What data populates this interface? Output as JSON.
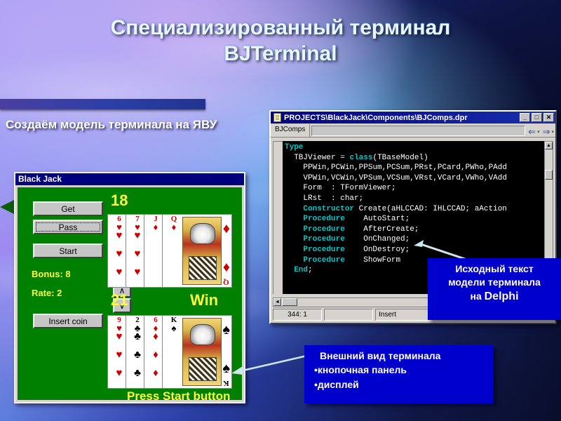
{
  "slide": {
    "title_line1": "Специализированный терминал",
    "title_line2": "BJTerminal",
    "subtitle": "Создаём модель терминала на ЯВУ",
    "accent_color": "#0000cc",
    "title_color": "#e8f6ff"
  },
  "blackjack": {
    "window_title": "Black Jack",
    "buttons": {
      "get": "Get",
      "pass": "Pass",
      "start": "Start",
      "insert_coin": "Insert coin"
    },
    "spinner": {
      "up": "∧",
      "down": "∨"
    },
    "stats": {
      "bonus_label": "Bonus: 8",
      "rate_label": "Rate: 2"
    },
    "score_top": "18",
    "score_bottom": "21",
    "result": "Win",
    "prompt": "Press Start button",
    "hand_top": [
      {
        "rank": "6",
        "suit": "♥",
        "color": "red",
        "face": false
      },
      {
        "rank": "7",
        "suit": "♥",
        "color": "red",
        "face": false
      },
      {
        "rank": "J",
        "suit": "♦",
        "color": "red",
        "face": true
      },
      {
        "rank": "Q",
        "suit": "♦",
        "color": "red",
        "face": true
      }
    ],
    "hand_bottom": [
      {
        "rank": "9",
        "suit": "♥",
        "color": "red",
        "face": false
      },
      {
        "rank": "2",
        "suit": "♣",
        "color": "black",
        "face": false
      },
      {
        "rank": "6",
        "suit": "♦",
        "color": "red",
        "face": false
      },
      {
        "rank": "K",
        "suit": "♠",
        "color": "black",
        "face": true
      }
    ]
  },
  "ide": {
    "title": "PROJECTS\\BlackJack\\Components\\BJComps.dpr",
    "window_buttons": {
      "minimize": "_",
      "maximize": "□",
      "close": "✕"
    },
    "tab": "BJComps",
    "nav": {
      "back": "⇐",
      "forward": "⇒",
      "dropdown": "▾"
    },
    "code_lines": [
      {
        "text": "Type",
        "kw_len": 4,
        "indent": 0
      },
      {
        "text": "  TBJViewer = class(TBaseModel)",
        "indent": 0
      },
      {
        "text": "    PPWin,PCWin,PPSum,PCSum,PRst,PCard,PWho,PAdd",
        "indent": 0
      },
      {
        "text": "    VPWin,VCWin,VPSum,VCSum,VRst,VCard,VWho,VAdd",
        "indent": 0
      },
      {
        "text": "    Form  : TFormViewer;",
        "indent": 0
      },
      {
        "text": "    LRst  : char;",
        "indent": 0
      },
      {
        "text": "    Constructor Create(aHLCCAD: IHLCCAD; aAction",
        "indent": 0
      },
      {
        "text": "    Procedure    AutoStart;",
        "indent": 0
      },
      {
        "text": "    Procedure    AfterCreate;",
        "indent": 0
      },
      {
        "text": "    Procedure    OnChanged;",
        "indent": 0
      },
      {
        "text": "    Procedure    OnDestroy;",
        "indent": 0
      },
      {
        "text": "    Procedure    ShowForm",
        "indent": 0
      },
      {
        "text": "  End;",
        "indent": 0
      }
    ],
    "status": {
      "position": "344:  1",
      "modified": "",
      "insert_mode": "Insert"
    },
    "scroll": {
      "up": "▲",
      "down": "▼",
      "left": "◄",
      "right": "►"
    }
  },
  "callouts": {
    "delphi": {
      "line1": "Исходный текст",
      "line2": "модели терминала",
      "line3_prefix": "на ",
      "line3_word": "Delphi"
    },
    "appearance": {
      "header": "Внешний вид терминала",
      "bullet1": "•кнопочная панель",
      "bullet2": "•дисплей"
    }
  }
}
